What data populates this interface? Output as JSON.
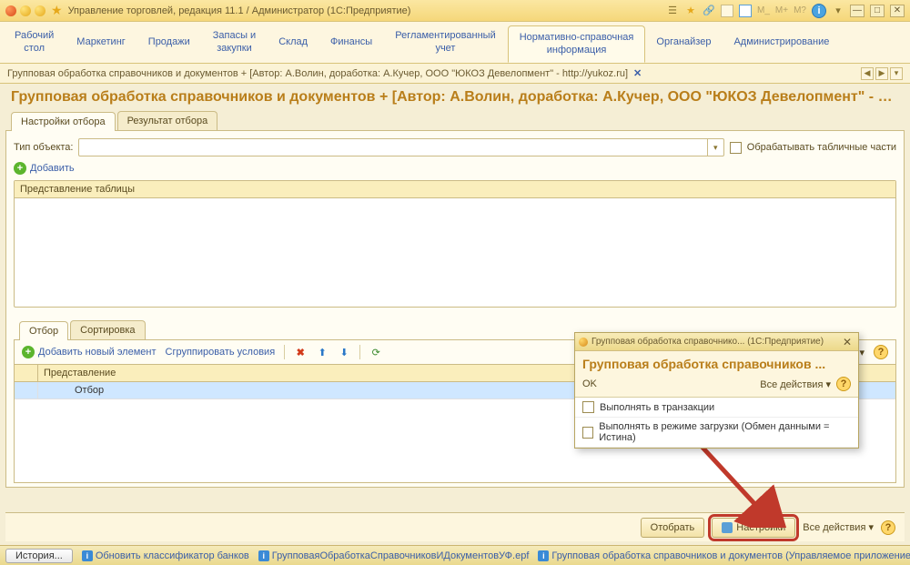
{
  "titlebar": {
    "title": "Управление торговлей, редакция 11.1 / Администратор   (1С:Предприятие)",
    "m_labels": [
      "M_",
      "M+",
      "M?"
    ]
  },
  "nav": {
    "items": [
      "Рабочий\nстол",
      "Маркетинг",
      "Продажи",
      "Запасы и\nзакупки",
      "Склад",
      "Финансы",
      "Регламентированный\nучет",
      "Нормативно-справочная\nинформация",
      "Органайзер",
      "Администрирование"
    ],
    "active_index": 7
  },
  "docpath": {
    "text": "Групповая обработка справочников и документов + [Автор: А.Волин, доработка: А.Кучер, ООО \"ЮКОЗ Девелопмент\" - http://yukoz.ru]"
  },
  "page": {
    "title": "Групповая обработка справочников и документов + [Автор: А.Волин, доработка: А.Кучер, ООО \"ЮКОЗ Девелопмент\" - http:..."
  },
  "tabs1": {
    "items": [
      "Настройки отбора",
      "Результат отбора"
    ],
    "active_index": 0
  },
  "filter": {
    "type_label": "Тип объекта:",
    "type_value": "",
    "process_tables_label": "Обрабатывать табличные части",
    "add_label": "Добавить",
    "table_header": "Представление таблицы"
  },
  "tabs2": {
    "items": [
      "Отбор",
      "Сортировка"
    ],
    "active_index": 0
  },
  "toolbar2": {
    "add_new": "Добавить новый элемент",
    "group": "Сгруппировать условия",
    "all_actions": "Все действия"
  },
  "grid": {
    "header": "Представление",
    "rows": [
      "Отбор"
    ]
  },
  "actions": {
    "select": "Отобрать",
    "settings": "Настройки",
    "all_actions": "Все действия"
  },
  "statusbar": {
    "history": "История...",
    "items": [
      "Обновить классификатор банков",
      "ГрупповаяОбработкаСправочниковИДокументовУФ.epf",
      "Групповая обработка справочников и документов (Управляемое приложение)"
    ]
  },
  "popup": {
    "window_title": "Групповая обработка справочнико...   (1С:Предприятие)",
    "title": "Групповая обработка справочников ...",
    "ok": "OK",
    "all_actions": "Все действия",
    "option1": "Выполнять в транзакции",
    "option2": "Выполнять в режиме загрузки (Обмен данными = Истина)"
  }
}
